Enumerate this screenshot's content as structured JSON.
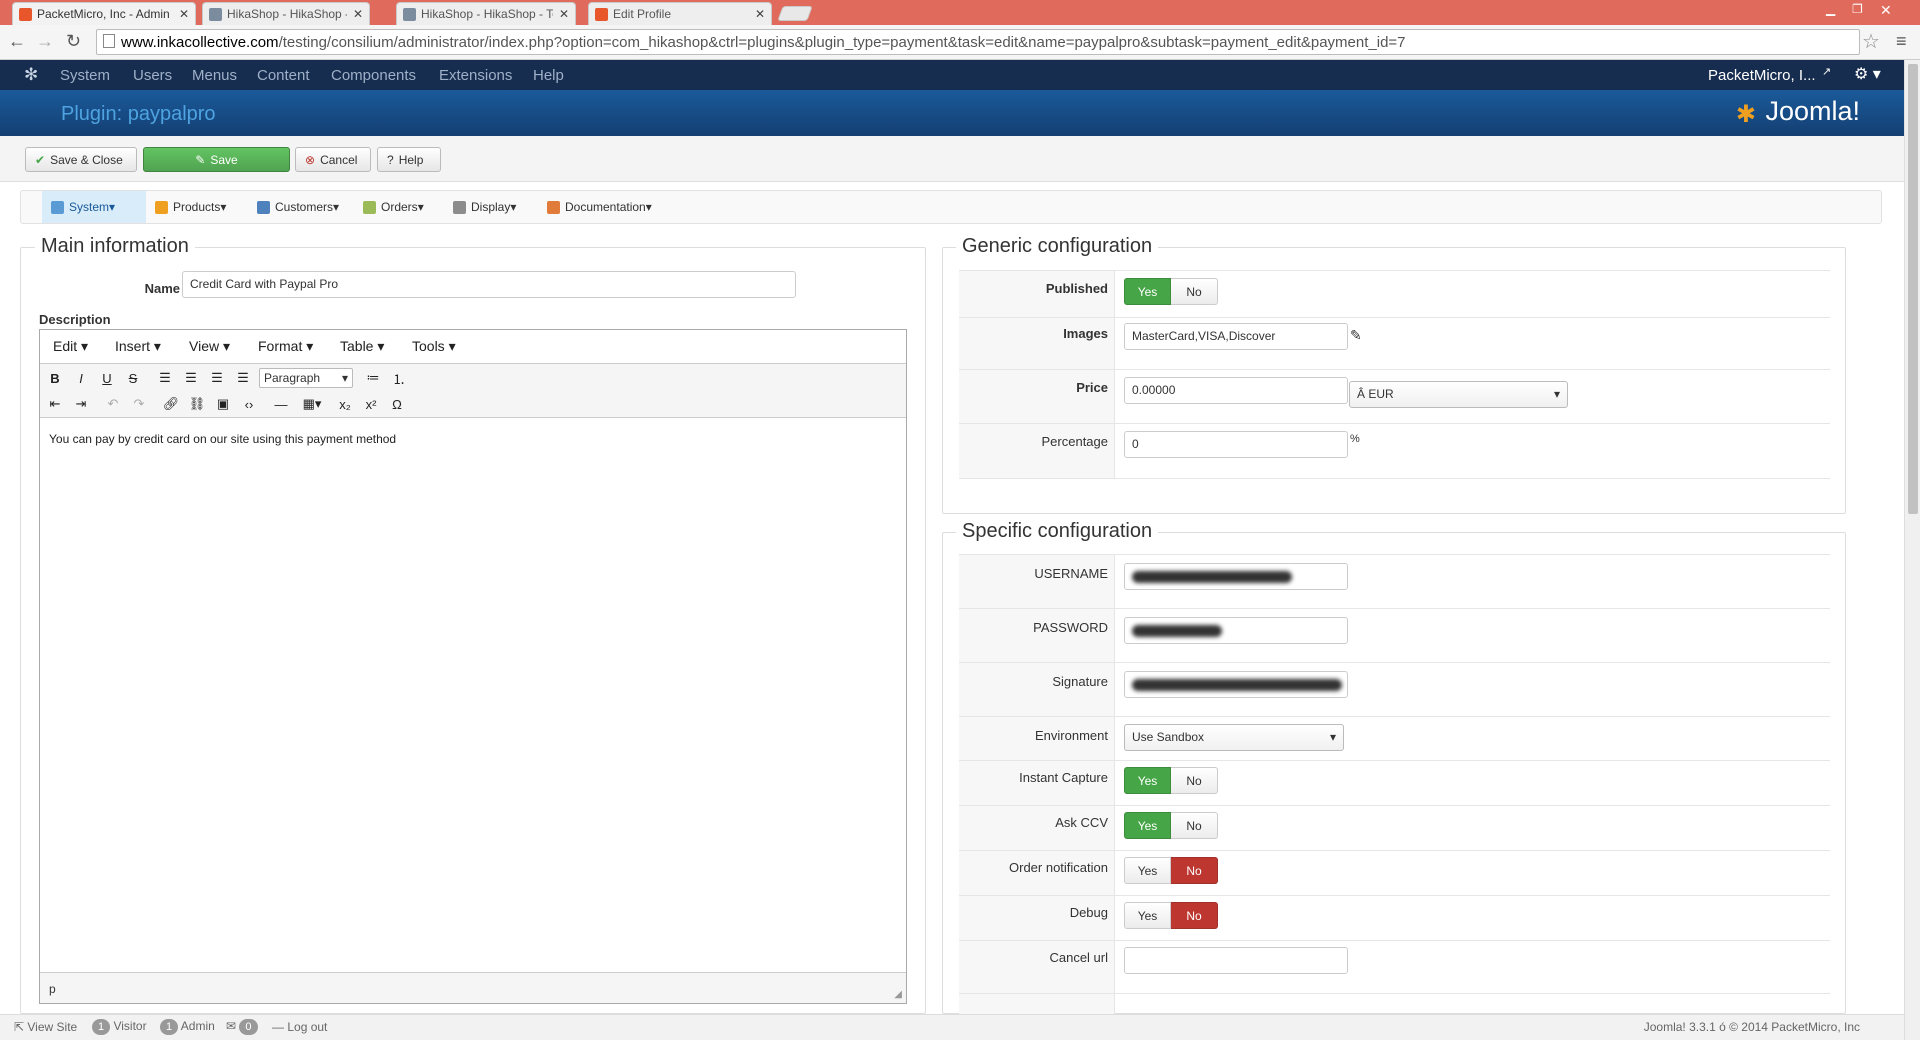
{
  "browser": {
    "tabs": [
      {
        "title": "PacketMicro, Inc - Admin",
        "active": true
      },
      {
        "title": "HikaShop - HikaShop - Ac",
        "active": false
      },
      {
        "title": "HikaShop - HikaShop - To",
        "active": false
      },
      {
        "title": "Edit Profile",
        "active": false
      }
    ],
    "url_domain": "www.inkacollective.com",
    "url_path": "/testing/consilium/administrator/index.php?option=com_hikashop&ctrl=plugins&plugin_type=payment&task=edit&name=paypalpro&subtask=payment_edit&payment_id=7"
  },
  "topnav": {
    "items": [
      "System",
      "Users",
      "Menus",
      "Content",
      "Components",
      "Extensions",
      "Help"
    ],
    "user": "PacketMicro, I..."
  },
  "header": {
    "title": "Plugin: paypalpro",
    "logo_text": "Joomla!"
  },
  "toolbar": {
    "save_close": "Save & Close",
    "save": "Save",
    "cancel": "Cancel",
    "help": "Help"
  },
  "submenu": [
    "System",
    "Products",
    "Customers",
    "Orders",
    "Display",
    "Documentation"
  ],
  "main_info": {
    "legend": "Main information",
    "name_label": "Name",
    "name_value": "Credit Card with Paypal Pro",
    "description_label": "Description",
    "editor_menu": [
      "Edit",
      "Insert",
      "View",
      "Format",
      "Table",
      "Tools"
    ],
    "format_select": "Paragraph",
    "content": "You can pay by credit card on our site using this payment method",
    "path": "p"
  },
  "generic": {
    "legend": "Generic configuration",
    "published_label": "Published",
    "yes": "Yes",
    "no": "No",
    "images_label": "Images",
    "images_value": "MasterCard,VISA,Discover",
    "price_label": "Price",
    "price_value": "0.00000",
    "currency": "Â EUR",
    "percentage_label": "Percentage",
    "percentage_value": "0",
    "percent_sign": "%"
  },
  "specific": {
    "legend": "Specific configuration",
    "username_label": "USERNAME",
    "password_label": "PASSWORD",
    "signature_label": "Signature",
    "environment_label": "Environment",
    "environment_value": "Use Sandbox",
    "instant_capture_label": "Instant Capture",
    "ask_ccv_label": "Ask CCV",
    "order_notification_label": "Order notification",
    "debug_label": "Debug",
    "cancel_url_label": "Cancel url"
  },
  "footer": {
    "view_site": "View Site",
    "visitor_count": "1",
    "visitor": "Visitor",
    "admin_count": "1",
    "admin": "Admin",
    "msg_count": "0",
    "logout": "Log out",
    "copyright": "Joomla! 3.3.1  ó  © 2014 PacketMicro, Inc"
  },
  "colors": {
    "tabstrip": "#e06b5c",
    "nav": "#162d4f",
    "header": "#1a5a9a",
    "yes_active": "#46a546",
    "no_active": "#bd362f"
  }
}
